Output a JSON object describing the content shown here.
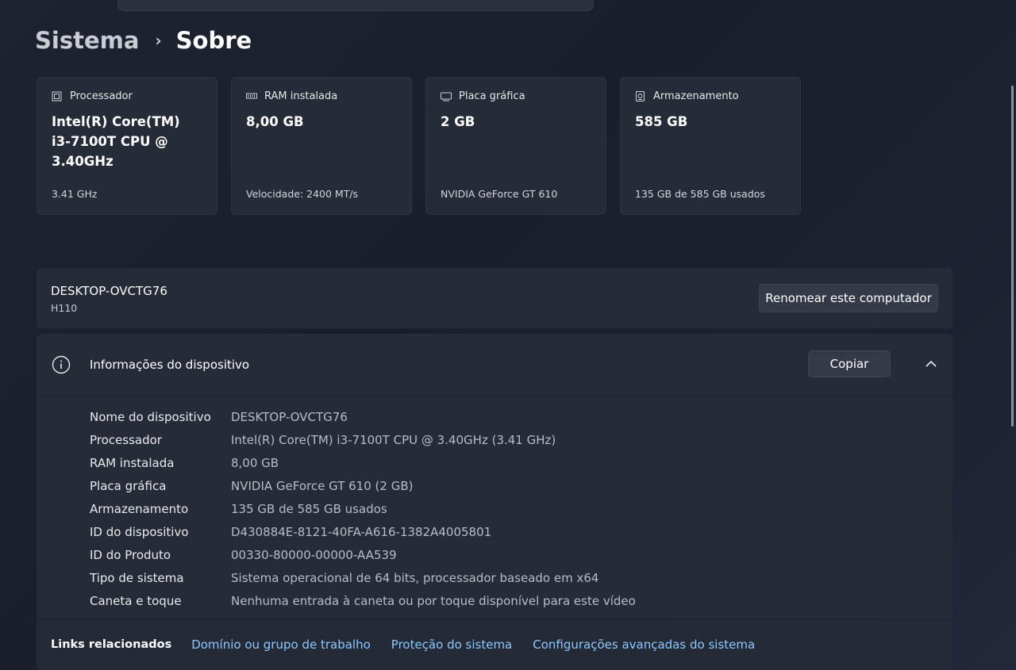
{
  "breadcrumb": {
    "parent": "Sistema",
    "separator": "›",
    "current": "Sobre"
  },
  "cards": [
    {
      "icon": "processor-icon",
      "label": "Processador",
      "value": "Intel(R) Core(TM) i3-7100T CPU @ 3.40GHz",
      "sub": "3.41 GHz"
    },
    {
      "icon": "ram-icon",
      "label": "RAM instalada",
      "value": "8,00 GB",
      "sub": "Velocidade: 2400 MT/s"
    },
    {
      "icon": "graphics-card-icon",
      "label": "Placa gráfica",
      "value": "2 GB",
      "sub": "NVIDIA GeForce GT 610"
    },
    {
      "icon": "storage-icon",
      "label": "Armazenamento",
      "value": "585 GB",
      "sub": "135 GB de 585 GB usados"
    }
  ],
  "computer": {
    "name": "DESKTOP-OVCTG76",
    "model": "H110",
    "rename_label": "Renomear este computador"
  },
  "device_info": {
    "title": "Informações do dispositivo",
    "copy_label": "Copiar",
    "rows": [
      {
        "label": "Nome do dispositivo",
        "value": "DESKTOP-OVCTG76"
      },
      {
        "label": "Processador",
        "value": "Intel(R) Core(TM) i3-7100T CPU @ 3.40GHz (3.41 GHz)"
      },
      {
        "label": "RAM instalada",
        "value": "8,00 GB"
      },
      {
        "label": "Placa gráfica",
        "value": "NVIDIA GeForce GT 610 (2 GB)"
      },
      {
        "label": "Armazenamento",
        "value": "135 GB de 585 GB usados"
      },
      {
        "label": "ID do dispositivo",
        "value": "D430884E-8121-40FA-A616-1382A4005801"
      },
      {
        "label": "ID do Produto",
        "value": "00330-80000-00000-AA539"
      },
      {
        "label": "Tipo de sistema",
        "value": "Sistema operacional de 64 bits, processador baseado em x64"
      },
      {
        "label": "Caneta e toque",
        "value": "Nenhuma entrada à caneta ou por toque disponível para este vídeo"
      }
    ]
  },
  "related_links": {
    "title": "Links relacionados",
    "links": [
      "Domínio ou grupo de trabalho",
      "Proteção do sistema",
      "Configurações avançadas do sistema"
    ]
  },
  "colors": {
    "link": "#8cc8ff",
    "card_bg": "#262b38"
  }
}
